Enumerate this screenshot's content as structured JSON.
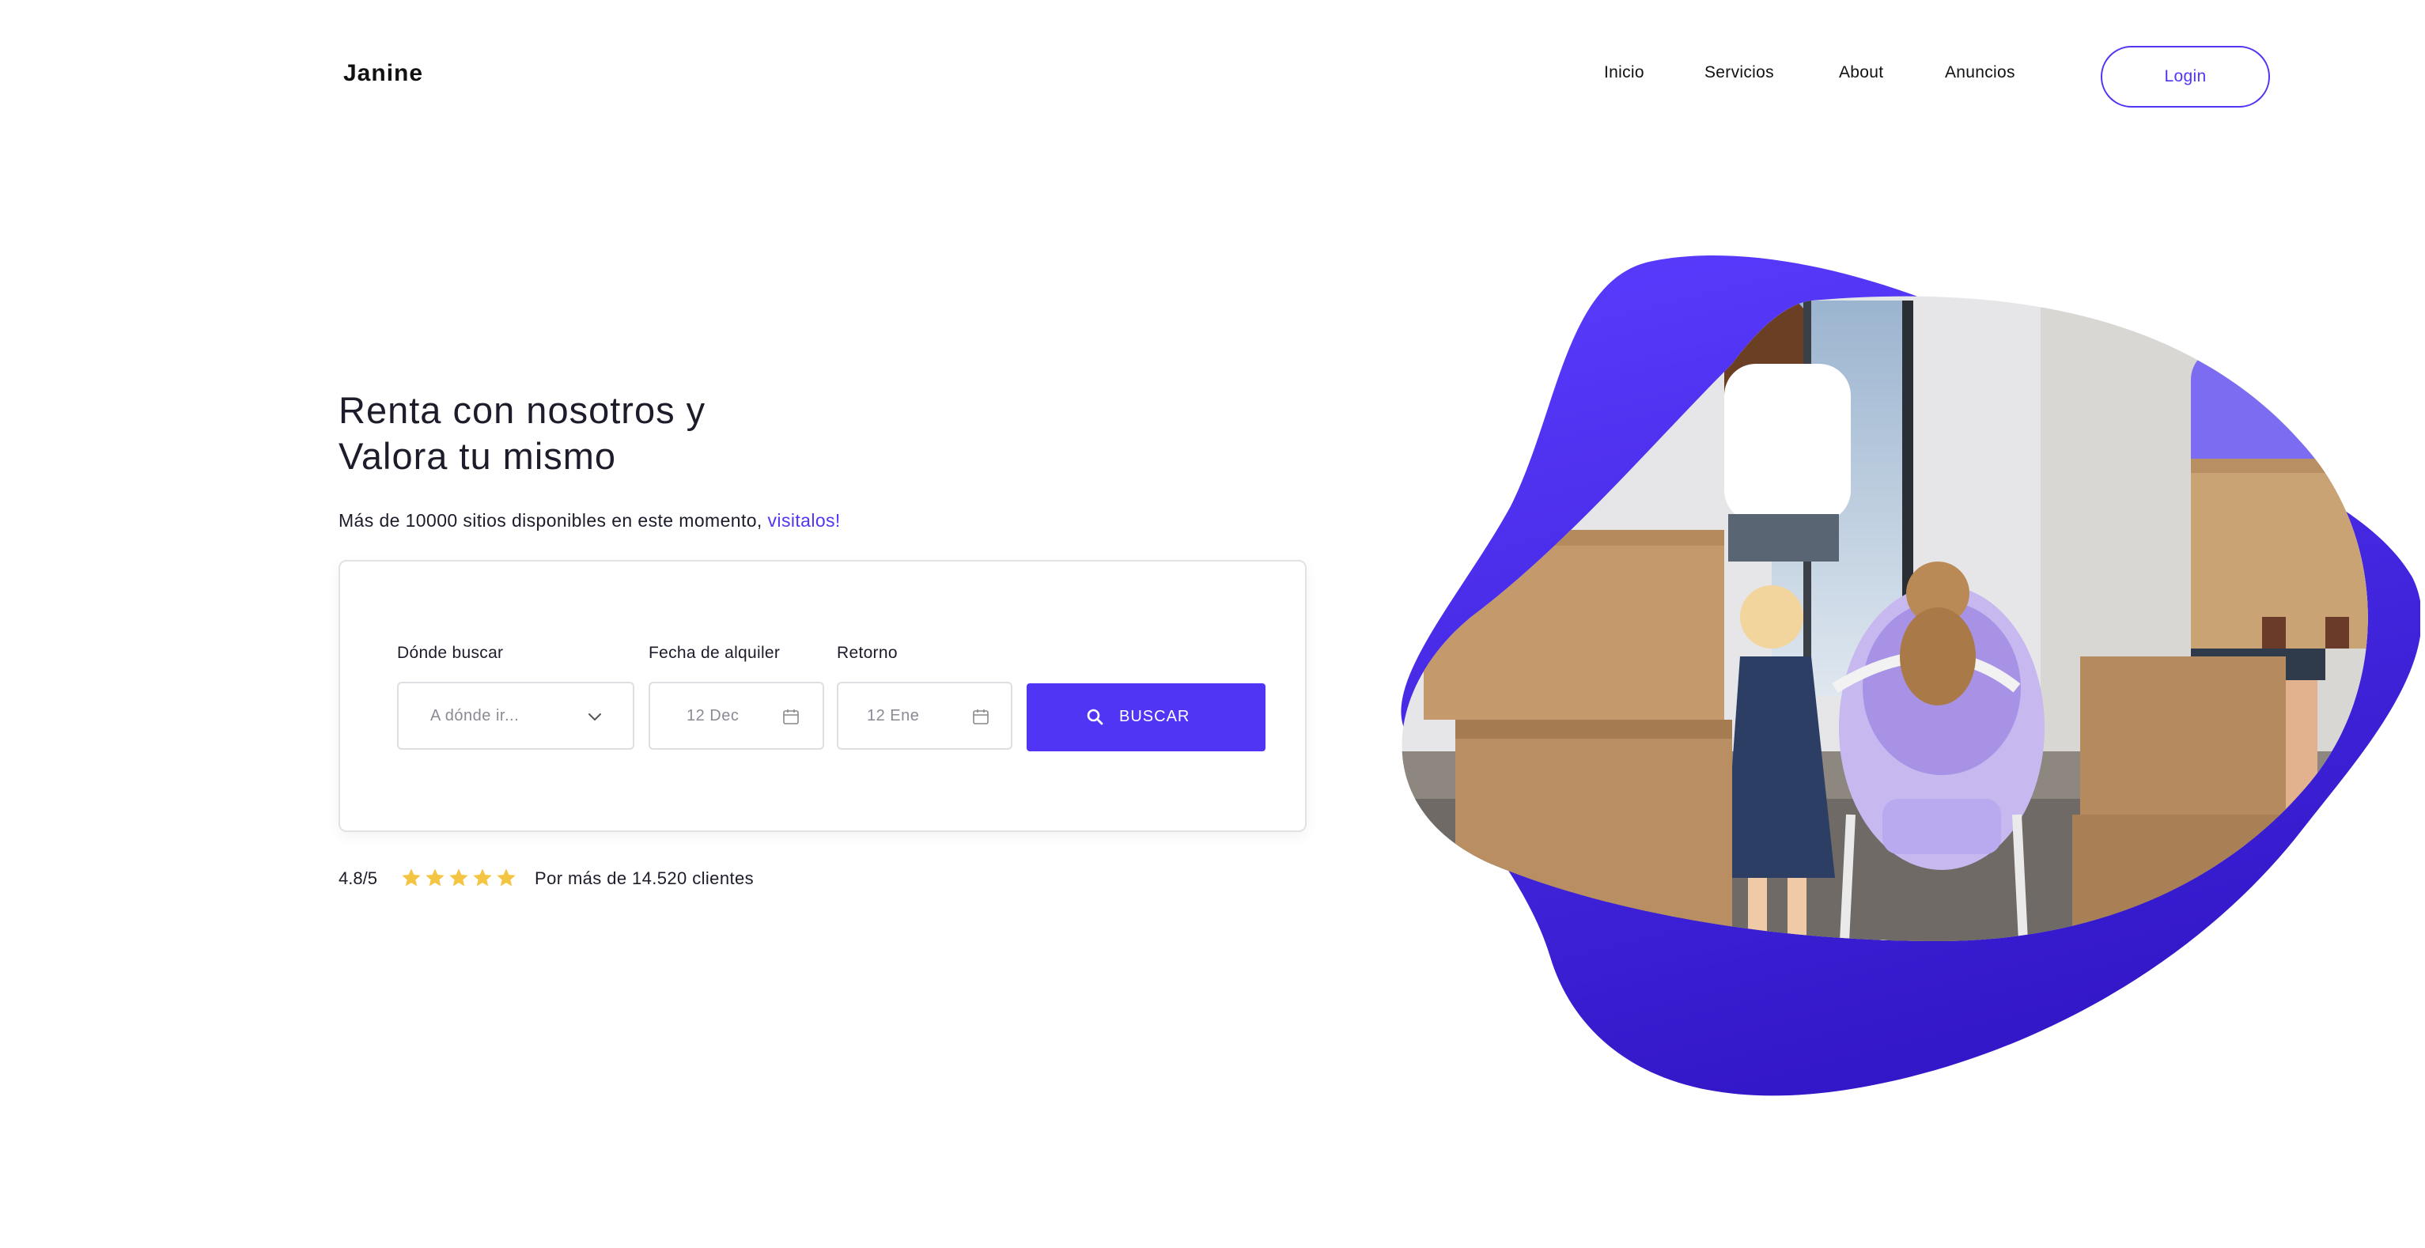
{
  "header": {
    "brand": "Janine",
    "nav": [
      {
        "label": "Inicio"
      },
      {
        "label": "Servicios"
      },
      {
        "label": "About"
      },
      {
        "label": "Anuncios"
      }
    ],
    "login_label": "Login"
  },
  "hero": {
    "title_line1": "Renta con nosotros y",
    "title_line2": "Valora tu mismo",
    "subtitle": "Más de 10000 sitios disponibles en este momento,",
    "subtitle_link": "visitalos!"
  },
  "search": {
    "where_label": "Dónde buscar",
    "where_placeholder": "A dónde ir...",
    "rental_label": "Fecha de alquiler",
    "rental_value": "12 Dec",
    "return_label": "Retorno",
    "return_value": "12 Ene",
    "button_label": "BUSCAR",
    "icons": {
      "where": "chevron-down-icon",
      "date": "calendar-icon",
      "button": "search-icon"
    }
  },
  "rating": {
    "score": "4.8/5",
    "stars": 5,
    "text": "Por más de 14.520 clientes"
  },
  "colors": {
    "accent": "#5035f5",
    "star": "#f4c542",
    "text": "#1c1c2a",
    "border": "#dedee3"
  }
}
